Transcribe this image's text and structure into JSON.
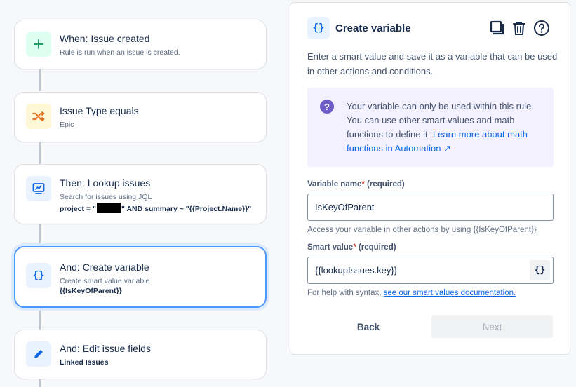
{
  "flow": {
    "cards": [
      {
        "title": "When: Issue created",
        "subtitle": "Rule is run when an issue is created.",
        "icon": "plus-icon",
        "icon_bg": "#dcfff1",
        "icon_color": "#22a06b"
      },
      {
        "title": "Issue Type equals",
        "subtitle": "Epic",
        "icon": "shuffle-icon",
        "icon_bg": "#fff7d6",
        "icon_color": "#e56910"
      },
      {
        "title": "Then: Lookup issues",
        "subtitle": "Search for issues using JQL",
        "extra_prefix": "project = \"",
        "extra_suffix": "\" AND summary ~ \"{{Project.Name}}\"",
        "icon": "monitor-icon",
        "icon_bg": "#e9f2ff",
        "icon_color": "#0c66e4"
      },
      {
        "title": "And: Create variable",
        "subtitle": "Create smart value variable",
        "extra": "{{IsKeyOfParent}}",
        "icon": "braces-icon",
        "icon_bg": "#e9f2ff",
        "icon_color": "#0c66e4",
        "icon_text": "{}"
      },
      {
        "title": "And: Edit issue fields",
        "subtitle": "Linked Issues",
        "icon": "pencil-icon",
        "icon_bg": "#e9f2ff",
        "icon_color": "#0c66e4"
      }
    ]
  },
  "panel": {
    "icon_text": "{}",
    "title": "Create variable",
    "description": "Enter a smart value and save it as a variable that can be used in other actions and conditions.",
    "info_icon": "?",
    "info_text": "Your variable can only be used within this rule. You can use other smart values and math functions to define it.",
    "info_link": "Learn more about math functions in Automation ↗",
    "var_name_label": "Variable name",
    "required_mark": "*",
    "required_text": "(required)",
    "var_name_value": "IsKeyOfParent",
    "var_name_help": "Access your variable in other actions by using {{IsKeyOfParent}}",
    "smart_value_label": "Smart value",
    "smart_value_value": "{{lookupIssues.key}}",
    "smart_value_btn": "{}",
    "syntax_help_prefix": "For help with syntax, ",
    "syntax_help_link": "see our smart values documentation.",
    "back_label": "Back",
    "next_label": "Next"
  }
}
